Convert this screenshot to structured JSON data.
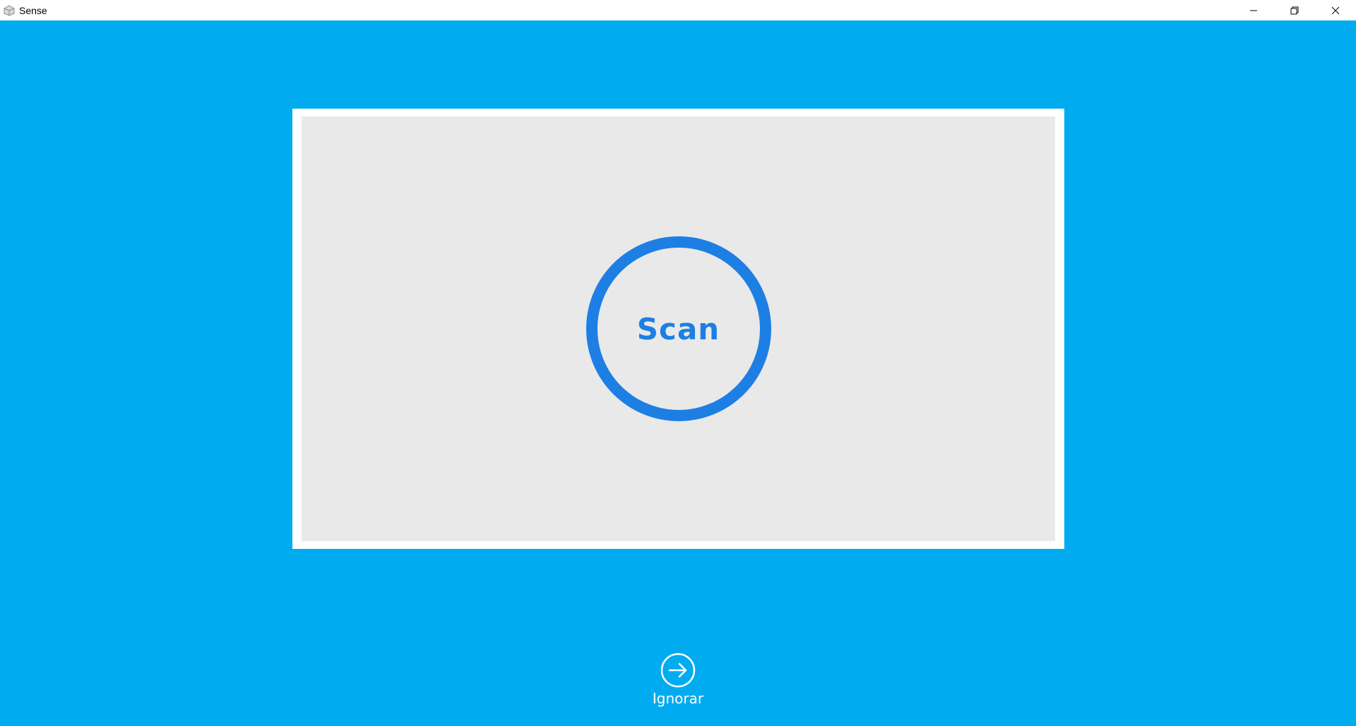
{
  "window": {
    "title": "Sense",
    "app_icon": "sense-cube-icon",
    "controls": {
      "minimize_icon": "minimize-icon",
      "restore_icon": "restore-icon",
      "close_icon": "close-icon"
    }
  },
  "colors": {
    "background": "#00acef",
    "scan_area": "#e9e9e9",
    "frame": "#ffffff",
    "accent": "#1d7fe3"
  },
  "scan": {
    "label": "Scan"
  },
  "skip": {
    "icon": "arrow-right-circle-icon",
    "label": "Ignorar"
  }
}
